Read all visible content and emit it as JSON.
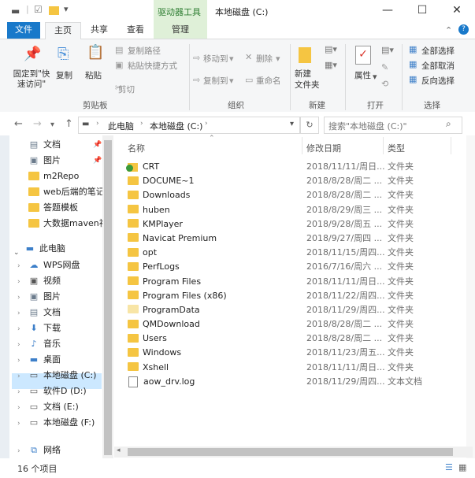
{
  "titlebar": {
    "context_tab": "驱动器工具",
    "title": "本地磁盘 (C:)",
    "minimize": "—",
    "maximize": "☐",
    "close": "✕"
  },
  "tabs": {
    "file": "文件",
    "home": "主页",
    "share": "共享",
    "view": "查看",
    "manage": "管理"
  },
  "ribbon": {
    "pin": "固定到\"快\n速访问\"",
    "copy": "复制",
    "paste": "粘贴",
    "copy_path": "复制路径",
    "paste_shortcut": "粘贴快捷方式",
    "cut": "剪切",
    "move_to": "移动到",
    "copy_to": "复制到",
    "delete": "删除",
    "rename": "重命名",
    "new_folder": "新建\n文件夹",
    "properties": "属性",
    "select_all": "全部选择",
    "select_none": "全部取消",
    "invert": "反向选择",
    "groups": {
      "clipboard": "剪贴板",
      "organize": "组织",
      "new": "新建",
      "open": "打开",
      "select": "选择"
    }
  },
  "address": {
    "crumb1": "此电脑",
    "crumb2": "本地磁盘 (C:)",
    "search_placeholder": "搜索\"本地磁盘 (C:)\""
  },
  "nav": {
    "quick": [
      {
        "label": "文档"
      },
      {
        "label": "图片"
      },
      {
        "label": "m2Repo"
      },
      {
        "label": "web后端的笔记"
      },
      {
        "label": "答题模板"
      },
      {
        "label": "大数据maven视"
      }
    ],
    "this_pc": "此电脑",
    "pc_items": [
      {
        "label": "WPS网盘"
      },
      {
        "label": "视频"
      },
      {
        "label": "图片"
      },
      {
        "label": "文档"
      },
      {
        "label": "下载"
      },
      {
        "label": "音乐"
      },
      {
        "label": "桌面"
      },
      {
        "label": "本地磁盘 (C:)"
      },
      {
        "label": "软件D (D:)"
      },
      {
        "label": "文档 (E:)"
      },
      {
        "label": "本地磁盘 (F:)"
      }
    ],
    "network": "网络"
  },
  "columns": {
    "name": "名称",
    "date": "修改日期",
    "type": "类型"
  },
  "files": [
    {
      "name": "CRT",
      "date": "2018/11/11/周日...",
      "type": "文件夹"
    },
    {
      "name": "DOCUME~1",
      "date": "2018/8/28/周二 ...",
      "type": "文件夹"
    },
    {
      "name": "Downloads",
      "date": "2018/8/28/周二 ...",
      "type": "文件夹"
    },
    {
      "name": "huben",
      "date": "2018/8/29/周三 ...",
      "type": "文件夹"
    },
    {
      "name": "KMPlayer",
      "date": "2018/9/28/周五 ...",
      "type": "文件夹"
    },
    {
      "name": "Navicat Premium",
      "date": "2018/9/27/周四 ...",
      "type": "文件夹"
    },
    {
      "name": "opt",
      "date": "2018/11/15/周四...",
      "type": "文件夹"
    },
    {
      "name": "PerfLogs",
      "date": "2016/7/16/周六 ...",
      "type": "文件夹"
    },
    {
      "name": "Program Files",
      "date": "2018/11/11/周日...",
      "type": "文件夹"
    },
    {
      "name": "Program Files (x86)",
      "date": "2018/11/22/周四...",
      "type": "文件夹"
    },
    {
      "name": "ProgramData",
      "date": "2018/11/29/周四...",
      "type": "文件夹"
    },
    {
      "name": "QMDownload",
      "date": "2018/8/28/周二 ...",
      "type": "文件夹"
    },
    {
      "name": "Users",
      "date": "2018/8/28/周二 ...",
      "type": "文件夹"
    },
    {
      "name": "Windows",
      "date": "2018/11/23/周五...",
      "type": "文件夹"
    },
    {
      "name": "Xshell",
      "date": "2018/11/11/周日...",
      "type": "文件夹"
    },
    {
      "name": "aow_drv.log",
      "date": "2018/11/29/周四...",
      "type": "文本文档"
    }
  ],
  "status": "16 个项目"
}
